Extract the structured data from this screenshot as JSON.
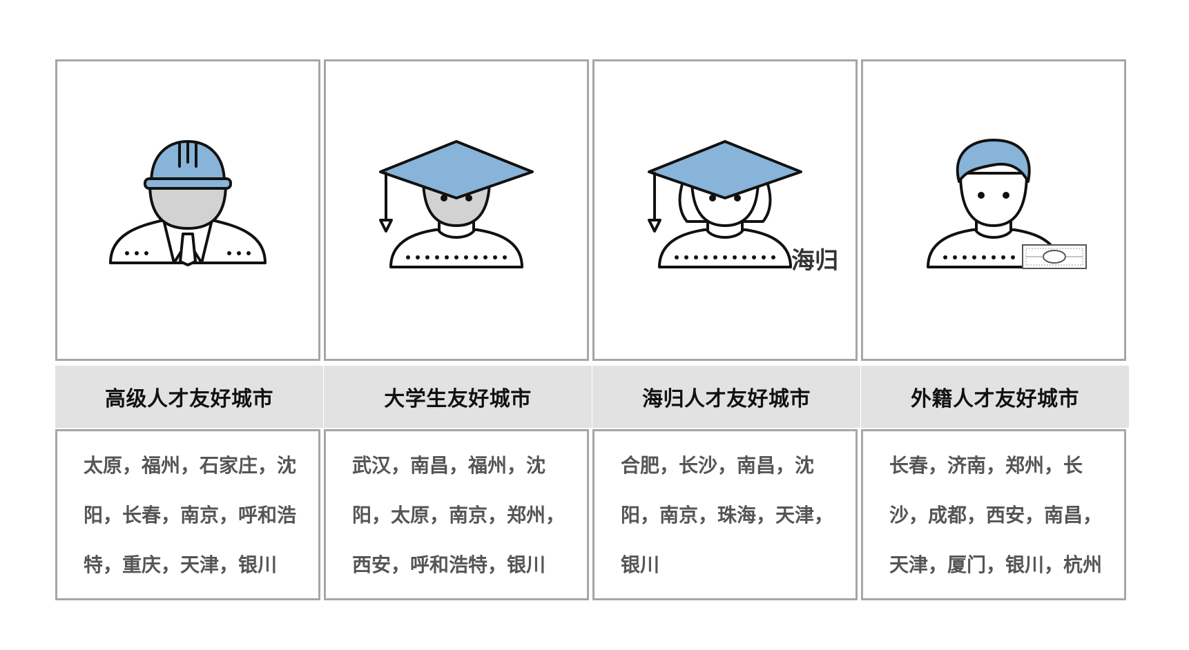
{
  "columns": [
    {
      "icon": "worker-hardhat-icon",
      "title": "高级人才友好城市",
      "cities": "太原，福州，石家庄，沈阳，长春，南京，呼和浩特，重庆，天津，银川"
    },
    {
      "icon": "graduate-cap-icon",
      "title": "大学生友好城市",
      "cities": "武汉，南昌，福州，沈阳，太原，南京，郑州，西安，呼和浩特，银川"
    },
    {
      "icon": "returnee-graduate-icon",
      "icon_label": "海归",
      "title": "海归人才友好城市",
      "cities": "合肥，长沙，南昌，沈阳，南京，珠海，天津，银川"
    },
    {
      "icon": "foreigner-money-icon",
      "title": "外籍人才友好城市",
      "cities": "长春，济南，郑州，长沙，成都，西安，南昌，天津，厦门，银川，杭州"
    }
  ],
  "colors": {
    "accent": "#87b4d8",
    "face": "#d2d2d2",
    "stroke": "#111111",
    "border": "#a6a6a6",
    "band": "#e2e2e2"
  }
}
